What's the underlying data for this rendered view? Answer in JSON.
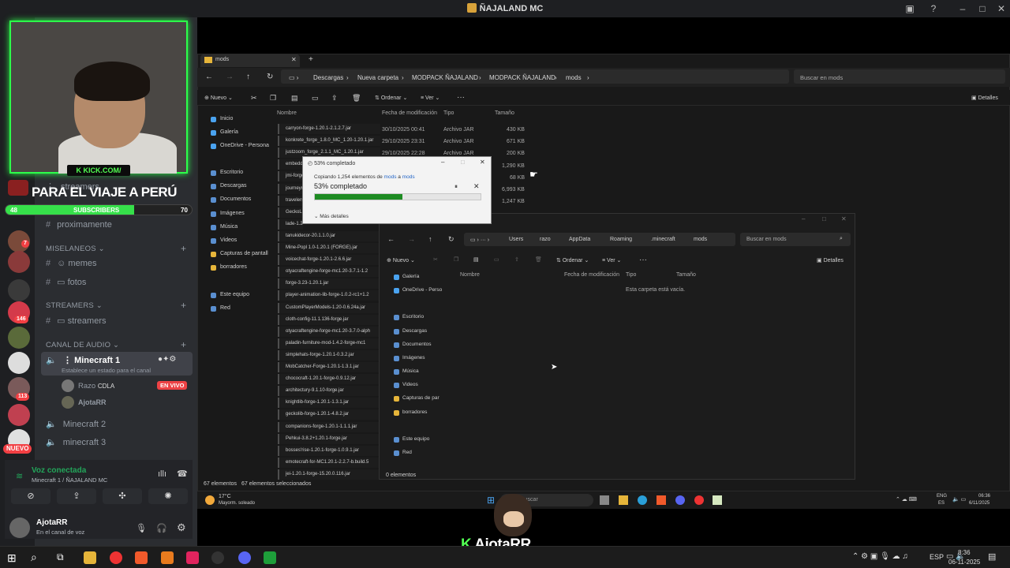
{
  "app_title": "ÑAJALAND MC",
  "stream": {
    "kick": "KICK.COM/",
    "banner": "PARA EL VIAJE A PERÚ",
    "sub_current": "48",
    "sub_label": "SUBSCRIBERS",
    "sub_goal": "70",
    "sub_progress": 0.69,
    "watermark": "AjotaRR"
  },
  "discord": {
    "server_badges": [
      "7",
      "146",
      "113"
    ],
    "new_badge": "NUEVO",
    "ch_streamers_top": "streamers",
    "ch_proximamente": "proximamente",
    "cat_miselaneos": "MISELANEOS",
    "ch_memes": "memes",
    "ch_fotos": "fotos",
    "cat_streamers": "STREAMERS",
    "ch_streamers": "streamers",
    "cat_audio": "CANAL DE AUDIO",
    "vc_minecraft1": "Minecraft 1",
    "vc_status": "Establece un estado para el canal",
    "user1": "Razo",
    "user1_tag": "CDLA",
    "live": "EN VIVO",
    "user2": "AjotaRR",
    "vc_minecraft2": "Minecraft 2",
    "vc_minecraft3": "minecraft 3",
    "voice_connected": "Voz conectada",
    "voice_channel": "Minecraft 1 / ÑAJALAND MC",
    "me_name": "AjotaRR",
    "me_status": "En el canal de voz"
  },
  "explorer1": {
    "tab": "mods",
    "breadcrumb": [
      "Descargas",
      "Nueva carpeta",
      "MODPACK ÑAJALAND",
      "MODPACK ÑAJALAND",
      "mods"
    ],
    "search": "Buscar en mods",
    "toolbar": {
      "new": "Nuevo",
      "sort": "Ordenar",
      "view": "Ver",
      "details": "Detalles"
    },
    "nav": [
      "Inicio",
      "Galería",
      "OneDrive - Persona",
      "Escritorio",
      "Descargas",
      "Documentos",
      "Imágenes",
      "Música",
      "Videos",
      "Capturas de pantall",
      "borradores",
      "Este equipo",
      "Red"
    ],
    "headers": {
      "name": "Nombre",
      "date": "Fecha de modificación",
      "type": "Tipo",
      "size": "Tamaño"
    },
    "rows_meta": [
      {
        "date": "30/10/2025 00:41",
        "type": "Archivo JAR",
        "size": "430 KB"
      },
      {
        "date": "29/10/2025 23:31",
        "type": "Archivo JAR",
        "size": "671 KB"
      },
      {
        "date": "29/10/2025 22:28",
        "type": "Archivo JAR",
        "size": "200 KB"
      }
    ],
    "extra_sizes": [
      "1,290 KB",
      "68 KB",
      "6,993 KB",
      "1,247 KB"
    ],
    "files": [
      "carryon-forge-1.20.1-2.1.2.7.jar",
      "konkrete_forge_1.8.0_MC_1.20-1.20.1.jar",
      "justzoom_forge_2.1.1_MC_1.20.1.jar",
      "embeddium",
      "jmi-forge",
      "journeym",
      "travelersb",
      "GeckoLi",
      "lade-1.20",
      "tanukidecor-20.1.1.0.jar",
      "Mine-Popl 1.0-1.20.1 (FORGE).jar",
      "voicechat-forge-1.20.1-2.6.6.jar",
      "otyacraftengine-forge-mc1.20-3.7.1-1.2",
      "forge-3.23-1.20.1.jar",
      "player-animation-lib-forge-1.0.2-rc1+1.2",
      "CustomPlayerModels-1.20-0.6.24a.jar",
      "cloth-config-11.1.136-forge.jar",
      "otyacraftengine-forge-mc1.20-3.7.0-alph",
      "paladin-furniture-mod-1.4.2-forge-mc1",
      "simplehats-forge-1.20.1-0.3.2.jar",
      "MobCatcher-Forge-1.20.1-1.3.1.jar",
      "chococraft-1.20.1-forge-0.9.12.jar",
      "architectury-9.1.10-forge.jar",
      "knightlib-forge-1.20.1-1.3.1.jar",
      "geckolib-forge-1.20.1-4.8.2.jar",
      "companions-forge-1.20.1-1.1.1.jar",
      "Pehkui-3.8.2+1.20.1-forge.jar",
      "bosses'rise-1.20.1-forge-1.0.9.1.jar",
      "emotecraft-for-MC1.20.1-2.2.7-b.build.5",
      "jei-1.20.1-forge-15.20.0.116.jar"
    ],
    "status": "67 elementos",
    "status_sel": "67 elementos seleccionados"
  },
  "explorer2": {
    "breadcrumb": [
      "Users",
      "razo",
      "AppData",
      "Roaming",
      ".minecraft",
      "mods"
    ],
    "search": "Buscar en mods",
    "toolbar": {
      "new": "Nuevo",
      "sort": "Ordenar",
      "view": "Ver",
      "details": "Detalles"
    },
    "nav": [
      "Galería",
      "OneDrive - Perso",
      "Escritorio",
      "Descargas",
      "Documentos",
      "Imágenes",
      "Música",
      "Videos",
      "Capturas de par",
      "borradores",
      "Este equipo",
      "Red"
    ],
    "headers": {
      "name": "Nombre",
      "date": "Fecha de modificación",
      "type": "Tipo",
      "size": "Tamaño"
    },
    "empty": "Esta carpeta está vacía.",
    "status": "0 elementos"
  },
  "copy_dialog": {
    "title": "53% completado",
    "copying_prefix": "Copiando 1,254 elementos de ",
    "from": "mods",
    "mid": " a ",
    "to": "mods",
    "percent_label": "53% completado",
    "progress": 0.53,
    "more": "Más detalles"
  },
  "inner_taskbar": {
    "weather_temp": "17°C",
    "weather_desc": "Mayorm. soleado",
    "search": "Buscar",
    "lang": "ENG",
    "region": "ES",
    "time": "06:36",
    "date": "6/11/2025"
  },
  "taskbar": {
    "lang": "ESP",
    "time": "8:36",
    "date": "06-11-2025"
  }
}
